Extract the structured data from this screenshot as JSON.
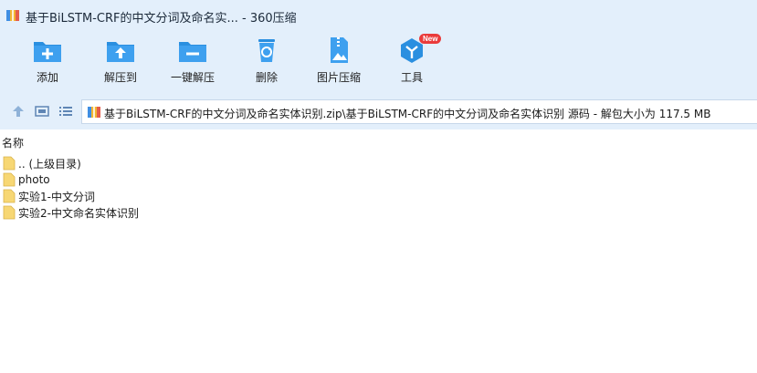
{
  "window": {
    "title": "基于BiLSTM-CRF的中文分词及命名实... - 360压缩",
    "icon": "archive-icon"
  },
  "toolbar": [
    {
      "id": "add",
      "label": "添加",
      "icon": "folder-plus-icon"
    },
    {
      "id": "extract",
      "label": "解压到",
      "icon": "folder-up-arrow-icon"
    },
    {
      "id": "quick-extract",
      "label": "一键解压",
      "icon": "folder-minus-icon"
    },
    {
      "id": "delete",
      "label": "删除",
      "icon": "recycle-bin-icon"
    },
    {
      "id": "image-compress",
      "label": "图片压缩",
      "icon": "image-zip-icon"
    },
    {
      "id": "tools",
      "label": "工具",
      "icon": "toolbox-hex-icon",
      "badge": "New"
    }
  ],
  "addressbar": {
    "path": "基于BiLSTM-CRF的中文分词及命名实体识别.zip\\基于BiLSTM-CRF的中文分词及命名实体识别 源码 - 解包大小为 117.5 MB",
    "nav_icons": [
      "up-arrow-icon",
      "detail-view-icon",
      "list-view-icon"
    ]
  },
  "list": {
    "column_name": "名称",
    "items": [
      {
        "label": ".. (上级目录)",
        "type": "folder"
      },
      {
        "label": "photo",
        "type": "folder"
      },
      {
        "label": "实验1-中文分词",
        "type": "folder"
      },
      {
        "label": "实验2-中文命名实体识别",
        "type": "folder"
      }
    ]
  },
  "colors": {
    "header_bg": "#e3effb",
    "icon_blue": "#2a8fe0",
    "folder_yellow": "#f7d774",
    "badge_red": "#ea3b3b"
  }
}
